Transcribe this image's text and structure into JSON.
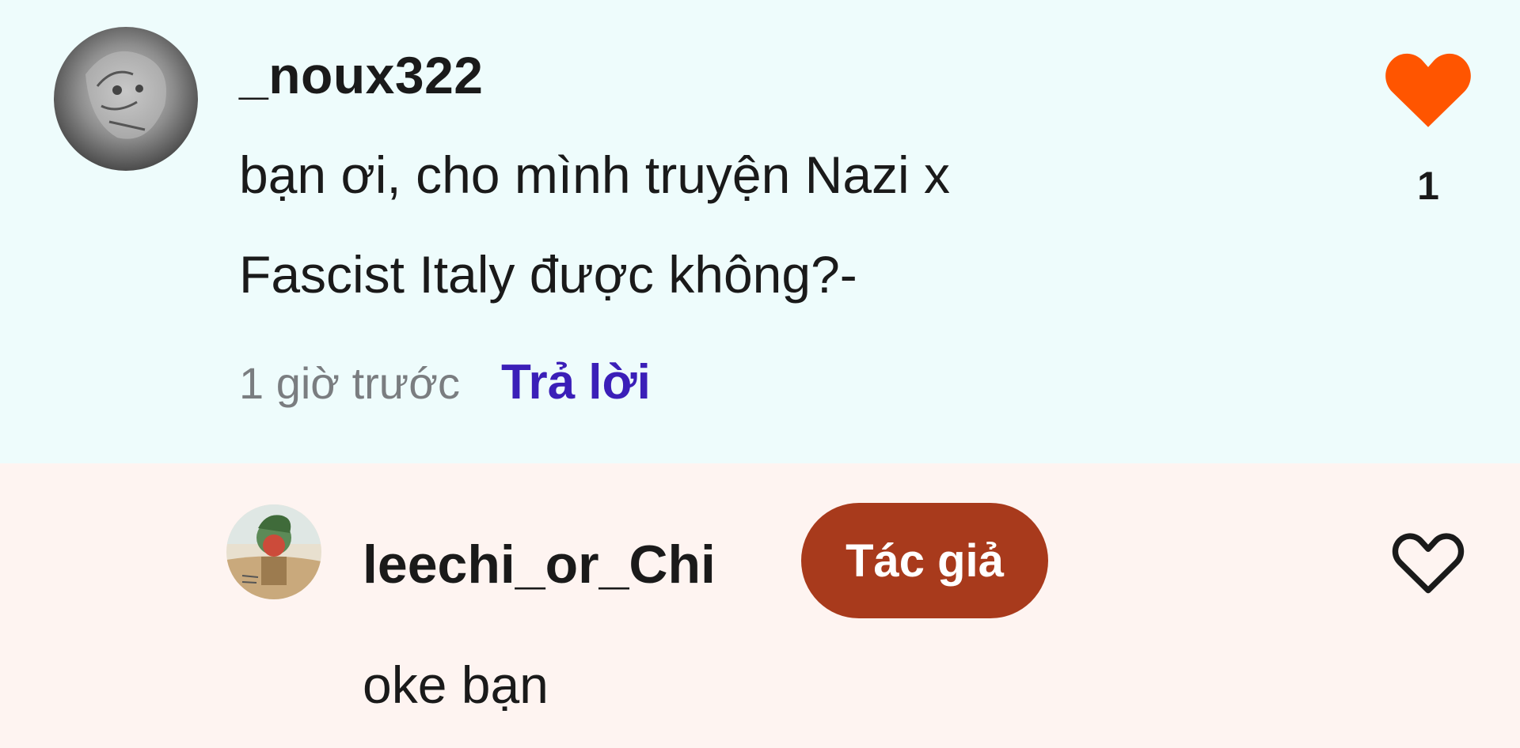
{
  "comment": {
    "username": "_noux322",
    "text_line1": "bạn ơi, cho mình truyện Nazi x",
    "text_line2": "Fascist Italy được không?-",
    "timestamp": "1 giờ trước",
    "reply_label": "Trả lời",
    "like_count": "1",
    "liked": true,
    "like_color": "#ff5500",
    "background": "#eefcfc"
  },
  "reply": {
    "username": "leechi_or_Chi",
    "author_badge": "Tác giả",
    "badge_color": "#a83a1c",
    "text": "oke bạn",
    "liked": false,
    "background": "#fef4f1"
  },
  "colors": {
    "reply_link": "#3b1fb8",
    "timestamp": "#7a7d80"
  },
  "icons": {
    "comment_like": "heart-filled-icon",
    "reply_like": "heart-outline-icon"
  }
}
